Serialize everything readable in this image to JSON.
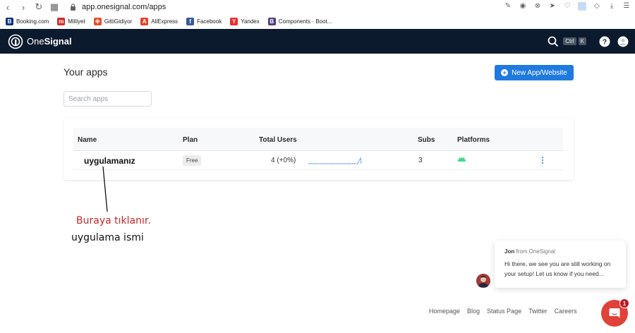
{
  "browser": {
    "url": "app.onesignal.com/apps"
  },
  "bookmarks": [
    {
      "label": "Booking.com",
      "icon": "booking-icon",
      "color": "#0a3580",
      "glyph": "B"
    },
    {
      "label": "Milliyet",
      "icon": "milliyet-icon",
      "color": "#d0312d",
      "glyph": "m"
    },
    {
      "label": "GittiGidiyor",
      "icon": "gittigidiyor-icon",
      "color": "#e94e2a",
      "glyph": "✤"
    },
    {
      "label": "AliExpress",
      "icon": "aliexpress-icon",
      "color": "#e4442a",
      "glyph": "A"
    },
    {
      "label": "Facebook",
      "icon": "facebook-icon",
      "color": "#3b5998",
      "glyph": "f"
    },
    {
      "label": "Yandex",
      "icon": "yandex-icon",
      "color": "#ef2d2d",
      "glyph": "Y"
    },
    {
      "label": "Components · Boot...",
      "icon": "bootstrap-icon",
      "color": "#563d7c",
      "glyph": "B"
    }
  ],
  "header": {
    "logo_text_light": "One",
    "logo_text_bold": "Signal",
    "shortcut_ctrl": "Ctrl",
    "shortcut_key": "K"
  },
  "main": {
    "title": "Your apps",
    "new_app_label": "New App/Website",
    "search_placeholder": "Search apps"
  },
  "table": {
    "headers": {
      "name": "Name",
      "plan": "Plan",
      "total_users": "Total Users",
      "subs": "Subs",
      "platforms": "Platforms"
    },
    "rows": [
      {
        "name": "uygulamanız",
        "plan": "Free",
        "total_users": "4 (+0%)",
        "subs": "3",
        "platform_icon": "android-icon"
      }
    ]
  },
  "annotation": {
    "red_text": "Buraya tıklanır.",
    "black_text": "uygulama ismi",
    "red_color": "#c62828"
  },
  "chat": {
    "from_name": "Jon",
    "from_suffix": " from OneSignal",
    "message": "Hi there, we see you are still working on your setup! Let us know if you need...",
    "unread_count": "1"
  },
  "footer": {
    "links": [
      "Homepage",
      "Blog",
      "Status Page",
      "Twitter",
      "Careers"
    ]
  },
  "colors": {
    "header_bg": "#0c1a2e",
    "accent": "#1f7ae0",
    "chat_launcher": "#e0423a"
  }
}
